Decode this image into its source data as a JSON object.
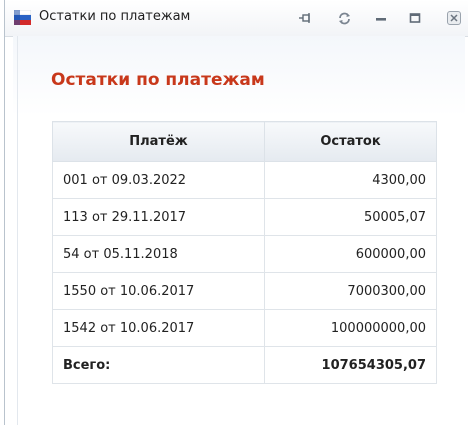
{
  "window": {
    "title": "Остатки по платежам"
  },
  "icons": {
    "app": "app-flag-icon",
    "pin": "pin-icon",
    "refresh": "refresh-icon",
    "minimize": "minimize-icon",
    "maximize": "maximize-icon",
    "close": "close-icon"
  },
  "content": {
    "heading": "Остатки по платежам"
  },
  "table": {
    "headers": [
      "Платёж",
      "Остаток"
    ],
    "rows": [
      {
        "payment": "001 от 09.03.2022",
        "balance": "4300,00"
      },
      {
        "payment": "113 от 29.11.2017",
        "balance": "50005,07"
      },
      {
        "payment": "54 от 05.11.2018",
        "balance": "600000,00"
      },
      {
        "payment": "1550 от 10.06.2017",
        "balance": "7000300,00"
      },
      {
        "payment": "1542 от 10.06.2017",
        "balance": "100000000,00"
      }
    ],
    "total": {
      "label": "Всего:",
      "value": "107654305,07"
    }
  },
  "colors": {
    "heading": "#c8381b",
    "border": "#dfe4e9"
  }
}
